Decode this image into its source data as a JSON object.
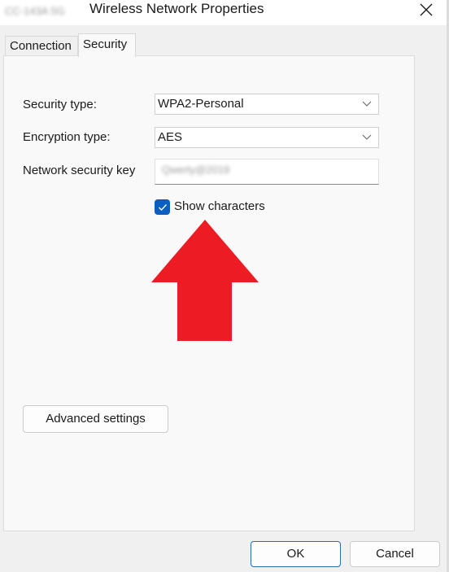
{
  "window": {
    "network_name_blurred": "CC-143A 5G",
    "title": "Wireless Network Properties",
    "close_icon": "close-icon"
  },
  "tabs": [
    {
      "label": "Connection",
      "active": false
    },
    {
      "label": "Security",
      "active": true
    }
  ],
  "security": {
    "security_type_label": "Security type:",
    "security_type_value": "WPA2-Personal",
    "encryption_type_label": "Encryption type:",
    "encryption_type_value": "AES",
    "key_label": "Network security key",
    "key_value_blurred": "Qwerty@2019",
    "show_characters_label": "Show characters",
    "show_characters_checked": true,
    "annotation": "red-up-arrow",
    "annotation_color": "#ed1c24"
  },
  "buttons": {
    "advanced": "Advanced settings",
    "ok": "OK",
    "cancel": "Cancel"
  },
  "colors": {
    "accent": "#0a5fc0",
    "arrow": "#ed1c24"
  }
}
